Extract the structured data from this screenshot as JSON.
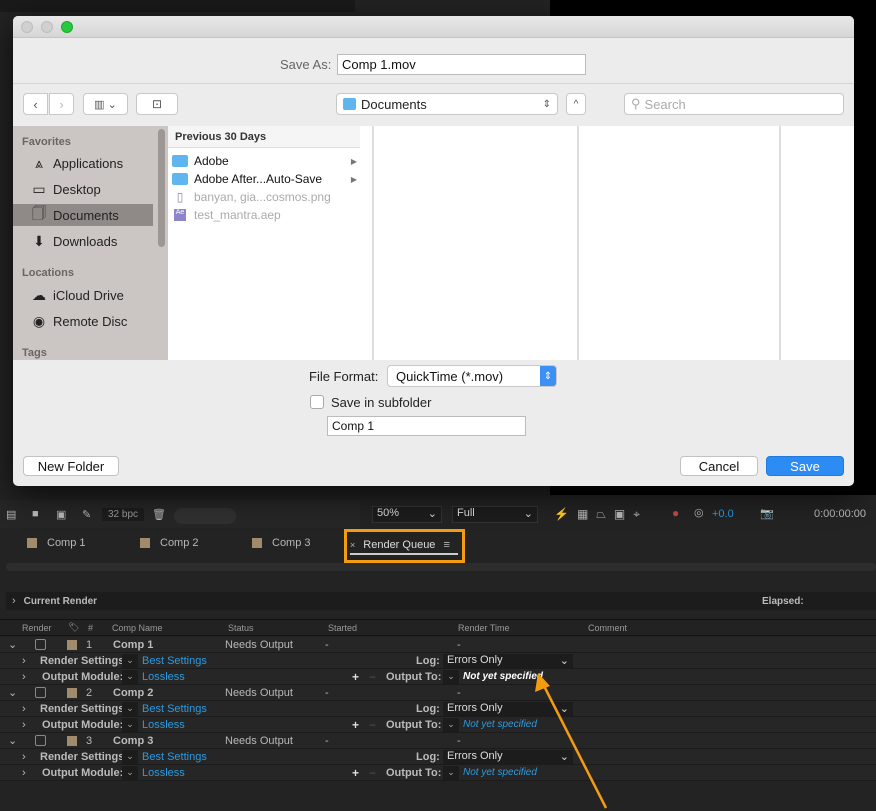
{
  "dialog": {
    "save_as_label": "Save As:",
    "save_as_value": "Comp 1.mov",
    "location": "Documents",
    "search_placeholder": "Search",
    "sidebar": {
      "favorites_header": "Favorites",
      "favorites": [
        {
          "label": "Applications",
          "icon": "applications-icon"
        },
        {
          "label": "Desktop",
          "icon": "desktop-icon"
        },
        {
          "label": "Documents",
          "icon": "documents-icon",
          "selected": true
        },
        {
          "label": "Downloads",
          "icon": "downloads-icon"
        }
      ],
      "locations_header": "Locations",
      "locations": [
        {
          "label": "iCloud Drive",
          "icon": "cloud-icon"
        },
        {
          "label": "Remote Disc",
          "icon": "disc-icon"
        }
      ],
      "tags_header": "Tags"
    },
    "column_header": "Previous 30 Days",
    "files": [
      {
        "name": "Adobe",
        "type": "folder"
      },
      {
        "name": "Adobe After...Auto-Save",
        "type": "folder"
      },
      {
        "name": "banyan, gia...cosmos.png",
        "type": "image",
        "disabled": true
      },
      {
        "name": "test_mantra.aep",
        "type": "aep",
        "disabled": true
      }
    ],
    "file_format_label": "File Format:",
    "file_format_value": "QuickTime (*.mov)",
    "subfolder_label": "Save in subfolder",
    "subfolder_checked": false,
    "subfolder_value": "Comp 1",
    "new_folder": "New Folder",
    "cancel": "Cancel",
    "save": "Save"
  },
  "ae": {
    "bpc": "32 bpc",
    "zoom": "50%",
    "resolution": "Full",
    "exposure": "+0.0",
    "timecode": "0:00:00:00",
    "tabs": [
      "Comp 1",
      "Comp 2",
      "Comp 3",
      "Render Queue"
    ],
    "current_render": "Current Render",
    "elapsed": "Elapsed:",
    "columns": [
      "Render",
      "#",
      "Comp Name",
      "Status",
      "Started",
      "Render Time",
      "Comment"
    ],
    "items": [
      {
        "num": "1",
        "name": "Comp 1",
        "status": "Needs Output",
        "started": "-",
        "render_time": "-",
        "render_settings": "Best Settings",
        "log": "Errors Only",
        "output_module": "Lossless",
        "output_to": "Not yet specified"
      },
      {
        "num": "2",
        "name": "Comp 2",
        "status": "Needs Output",
        "started": "-",
        "render_time": "-",
        "render_settings": "Best Settings",
        "log": "Errors Only",
        "output_module": "Lossless",
        "output_to": "Not yet specified"
      },
      {
        "num": "3",
        "name": "Comp 3",
        "status": "Needs Output",
        "started": "-",
        "render_time": "-",
        "render_settings": "Best Settings",
        "log": "Errors Only",
        "output_module": "Lossless",
        "output_to": "Not yet specified"
      }
    ],
    "labels": {
      "render_settings": "Render Settings:",
      "output_module": "Output Module:",
      "log": "Log:",
      "output_to": "Output To:"
    },
    "highlight_color": "#f39c12"
  }
}
